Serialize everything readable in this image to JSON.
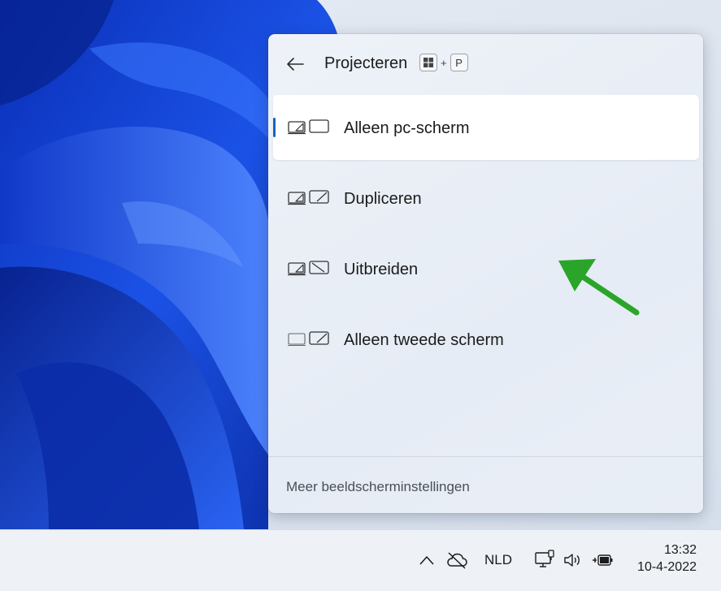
{
  "flyout": {
    "title": "Projecteren",
    "shortcut": {
      "key1_icon": "windows-logo-icon",
      "plus": "+",
      "key2": "P"
    },
    "options": [
      {
        "label": "Alleen pc-scherm",
        "icon": "pc-screen-only-icon",
        "selected": true
      },
      {
        "label": "Dupliceren",
        "icon": "duplicate-icon",
        "selected": false
      },
      {
        "label": "Uitbreiden",
        "icon": "extend-icon",
        "selected": false
      },
      {
        "label": "Alleen tweede scherm",
        "icon": "second-screen-only-icon",
        "selected": false
      }
    ],
    "footer_link": "Meer beeldscherminstellingen"
  },
  "annotation": {
    "arrow_color": "#2aa52a"
  },
  "taskbar": {
    "language": "NLD",
    "time": "13:32",
    "date": "10-4-2022"
  },
  "colors": {
    "accent": "#1f5fbf"
  }
}
